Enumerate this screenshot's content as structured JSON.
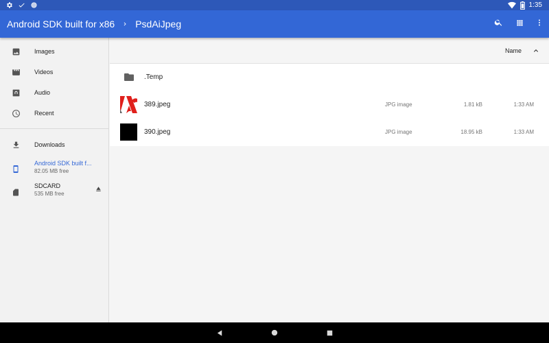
{
  "status_bar": {
    "time": "1:35",
    "left_icons": [
      "settings-icon",
      "check-icon",
      "sync-icon"
    ],
    "right_icons": [
      "wifi-icon",
      "battery-icon"
    ]
  },
  "toolbar": {
    "breadcrumbs": [
      "Android SDK built for x86",
      "PsdAiJpeg"
    ],
    "separator_icon": "chevron-right-icon",
    "actions": [
      "search-icon",
      "grid-view-icon",
      "more-vert-icon"
    ],
    "background": "#3367d6"
  },
  "drawer": {
    "roots": [
      {
        "label": "Images",
        "icon": "image-icon"
      },
      {
        "label": "Videos",
        "icon": "movie-icon"
      },
      {
        "label": "Audio",
        "icon": "audio-icon"
      },
      {
        "label": "Recent",
        "icon": "clock-icon"
      }
    ],
    "devices": [
      {
        "label": "Downloads",
        "icon": "download-icon"
      },
      {
        "title": "Android SDK built f...",
        "subtitle": "82.05 MB free",
        "icon": "phone-icon",
        "selected": true
      },
      {
        "title": "SDCARD",
        "subtitle": "535 MB free",
        "icon": "sdcard-icon",
        "action_icon": "eject-icon"
      }
    ],
    "selected_color": "#3367d6"
  },
  "content": {
    "sort": {
      "label": "Name",
      "direction_icon": "chevron-up-icon"
    },
    "files": [
      {
        "name": ".Temp",
        "kind": "folder",
        "type": "",
        "size": "",
        "date": ""
      },
      {
        "name": "389.jpeg",
        "kind": "image",
        "type": "JPG image",
        "size": "1.81 kB",
        "date": "1:33 AM"
      },
      {
        "name": "390.jpeg",
        "kind": "image",
        "type": "JPG image",
        "size": "18.95 kB",
        "date": "1:33 AM"
      }
    ]
  },
  "nav_bar": {
    "buttons": [
      "back-icon",
      "home-icon",
      "recents-icon"
    ]
  }
}
